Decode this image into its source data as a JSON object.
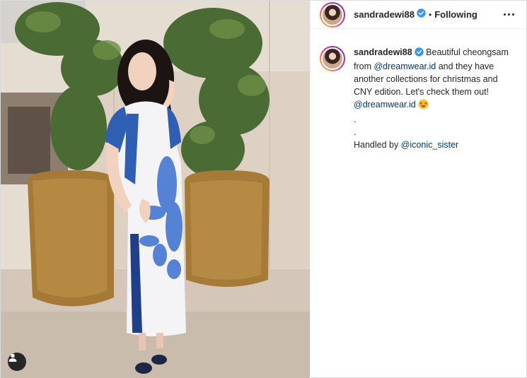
{
  "header": {
    "username": "sandradewi88",
    "separator": "•",
    "follow_status": "Following",
    "more_icon": "more-options-icon"
  },
  "caption": {
    "username": "sandradewi88",
    "text_1": "Beautiful cheongsam from ",
    "mention_1": "@dreamwear.id",
    "text_2": " and they have another collections for christmas and CNY edition. Let's check them out!",
    "mention_2": "@dreamwear.id",
    "emoji": "star-struck-emoji",
    "dot_1": ".",
    "dot_2": ".",
    "handled_by": "Handled by ",
    "mention_3": "@iconic_sister"
  },
  "photo": {
    "tag_icon": "user-tag-icon"
  },
  "colors": {
    "mention": "#00376b",
    "verified": "#3897f0",
    "text": "#262626"
  }
}
